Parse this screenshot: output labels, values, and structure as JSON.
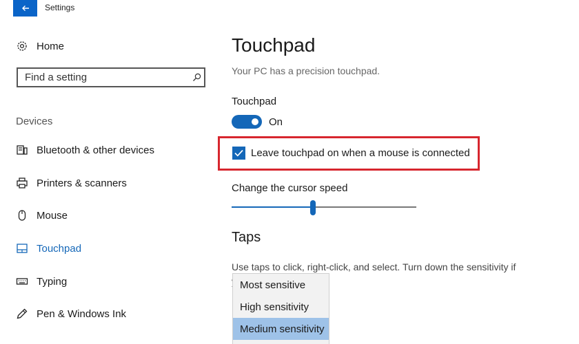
{
  "window": {
    "title": "Settings"
  },
  "sidebar": {
    "home_label": "Home",
    "search": {
      "placeholder": "Find a setting"
    },
    "section_label": "Devices",
    "items": [
      {
        "label": "Bluetooth & other devices",
        "icon": "bluetooth-devices-icon"
      },
      {
        "label": "Printers & scanners",
        "icon": "printer-icon"
      },
      {
        "label": "Mouse",
        "icon": "mouse-icon"
      },
      {
        "label": "Touchpad",
        "icon": "touchpad-icon",
        "active": true
      },
      {
        "label": "Typing",
        "icon": "keyboard-icon"
      },
      {
        "label": "Pen & Windows Ink",
        "icon": "pen-icon"
      }
    ]
  },
  "main": {
    "title": "Touchpad",
    "subtitle": "Your PC has a precision touchpad.",
    "touchpad_label": "Touchpad",
    "toggle": {
      "state": "On",
      "on": true
    },
    "checkbox": {
      "label": "Leave touchpad on when a mouse is connected",
      "checked": true
    },
    "cursor_speed": {
      "label": "Change the cursor speed",
      "value": 0.44
    },
    "taps": {
      "heading": "Taps",
      "description": "Use taps to click, right-click, and select. Turn down the sensitivity if you're typing",
      "options": [
        "Most sensitive",
        "High sensitivity",
        "Medium sensitivity"
      ],
      "selected_index": 2
    }
  },
  "colors": {
    "accent": "#1467b8",
    "highlight": "#d7262e",
    "selected_option": "#9ec2e8"
  }
}
